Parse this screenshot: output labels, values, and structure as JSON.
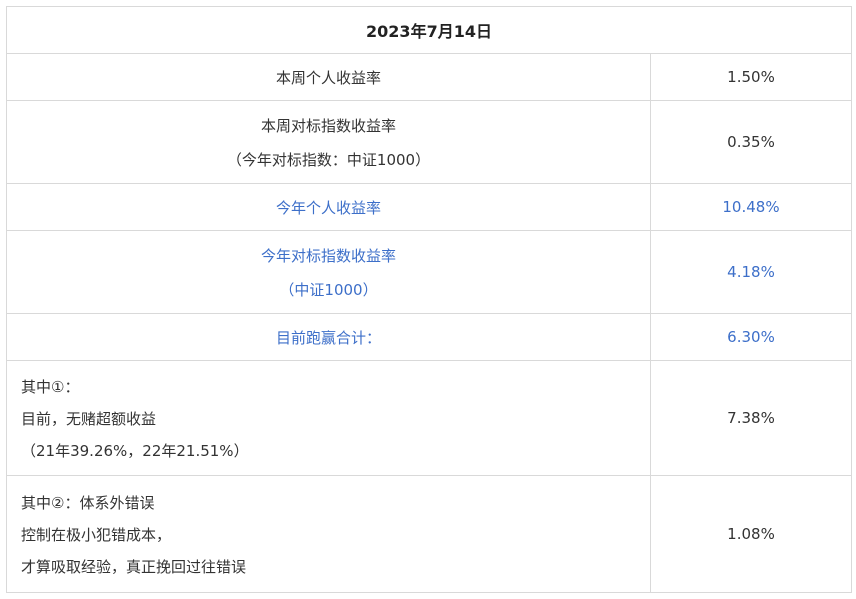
{
  "header": {
    "date": "2023年7月14日"
  },
  "rows": [
    {
      "label_lines": [
        "本周个人收益率"
      ],
      "value": "1.50%"
    },
    {
      "label_lines": [
        "本周对标指数收益率",
        "（今年对标指数：中证1000）"
      ],
      "value": "0.35%"
    },
    {
      "label_lines": [
        "今年个人收益率"
      ],
      "value": "10.48%"
    },
    {
      "label_lines": [
        "今年对标指数收益率",
        "（中证1000）"
      ],
      "value": "4.18%"
    },
    {
      "label_lines": [
        "目前跑赢合计："
      ],
      "value": "6.30%"
    },
    {
      "label_lines": [
        "其中①：",
        "目前，无赌超额收益",
        "（21年39.26%，22年21.51%）"
      ],
      "value": "7.38%"
    },
    {
      "label_lines": [
        "其中②：体系外错误",
        "控制在极小犯错成本，",
        "才算吸取经验，真正挽回过往错误"
      ],
      "value": "1.08%"
    }
  ],
  "colors": {
    "highlight": "#3d6fc9",
    "text": "#333333",
    "border": "#d9d9d9"
  }
}
